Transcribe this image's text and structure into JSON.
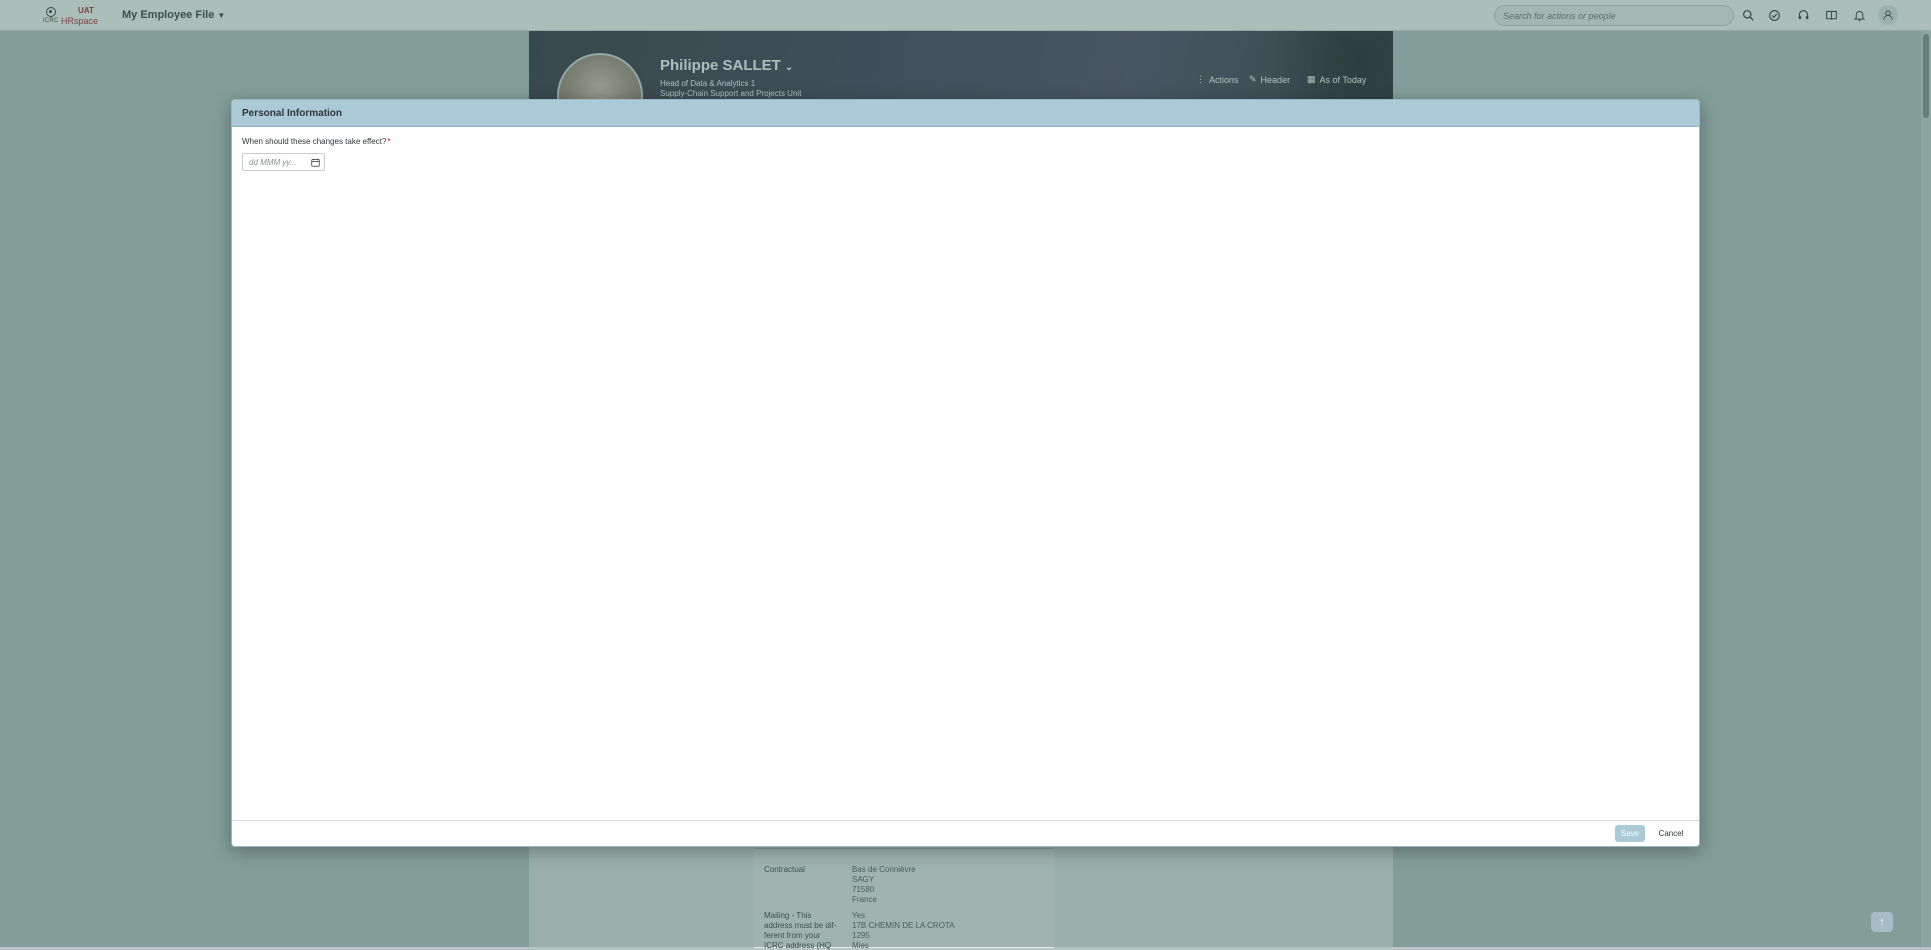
{
  "shell": {
    "logo": {
      "org": "ICRC",
      "env": "UAT",
      "brand": "HRspace"
    },
    "app_title": "My Employee File",
    "search_placeholder": "Search for actions or people"
  },
  "profile": {
    "name": "Philippe SALLET",
    "title_line": "Head of Data & Analytics 1",
    "unit_line": "Supply-Chain Support and Projects Unit",
    "actions_label": "Actions",
    "header_label": "Header",
    "as_of_label": "As of Today"
  },
  "addresses": {
    "contractual_label": "Contractual",
    "contractual_lines": [
      "Bas de Connièvre",
      "SAGY",
      "71580",
      "France"
    ],
    "mailing_label_lines": [
      "Mailing - This",
      "address must be dif-",
      "ferent from your",
      "ICRC address (HQ"
    ],
    "mailing_lines": [
      "Yes",
      "17B CHEMIN DE LA CROTA",
      "1295",
      "Mies"
    ]
  },
  "dialog": {
    "title": "Personal Information",
    "question": "When should these changes take effect?",
    "required_mark": "*",
    "date_placeholder": "dd MMM yy...",
    "save_label": "Save",
    "cancel_label": "Cancel"
  },
  "colors": {
    "dialog_header": "#a9cad6",
    "overlay": "#7aa39c",
    "save_disabled": "#a9cad6",
    "brand_red": "#b21f24"
  }
}
